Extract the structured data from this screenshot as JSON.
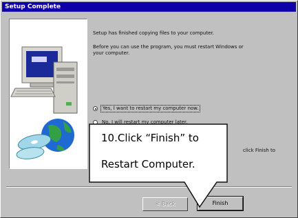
{
  "window": {
    "title": "Setup Complete"
  },
  "message": {
    "line1": "Setup has finished copying files to your computer.",
    "line2": "Before you can use the program, you must restart Windows or",
    "line3": "your computer.",
    "line4_right": "click Finish to"
  },
  "options": [
    {
      "label": "Yes, I want to restart my computer now.",
      "selected": true
    },
    {
      "label": "No, I will restart my computer later.",
      "selected": false
    }
  ],
  "buttons": {
    "back": "< Back",
    "finish": "Finish"
  },
  "callout": {
    "line1": "10.Click “Finish” to",
    "line2": "Restart Computer."
  },
  "colors": {
    "titlebar": "#1000a8",
    "dialog_bg": "#c0c0c0",
    "monitor_screen": "#1a2a98",
    "globe": "#1e6ad2"
  },
  "icons": [
    "computer-illustration-icon",
    "globe-icon",
    "cd-disc-icon"
  ]
}
